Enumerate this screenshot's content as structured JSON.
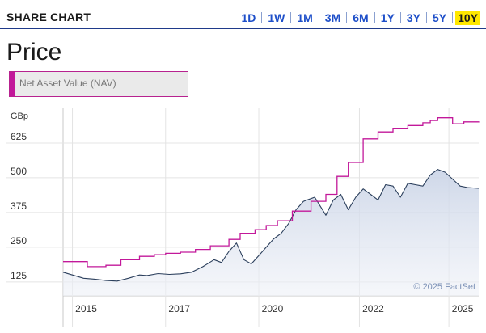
{
  "header": {
    "title": "SHARE CHART",
    "ranges": [
      "1D",
      "1W",
      "1M",
      "3M",
      "6M",
      "1Y",
      "3Y",
      "5Y",
      "10Y"
    ],
    "active_range": "10Y"
  },
  "price_title": "Price",
  "legend": {
    "label": "Net Asset Value (NAV)",
    "color": "#c2189a"
  },
  "colors": {
    "price_line": "#2b3f5c",
    "area_fill": "#dde4ef",
    "nav_line": "#c2189a",
    "accent": "#1e4fc9",
    "active_highlight": "#ffe800"
  },
  "chart_data": {
    "type": "line",
    "title": "",
    "xlabel": "",
    "ylabel": "GBp",
    "xlim": [
      2014.75,
      2025.9
    ],
    "ylim": [
      75,
      750
    ],
    "y_ticks": [
      125,
      250,
      375,
      500,
      625
    ],
    "x_ticks": [
      {
        "value": 2015,
        "label": "2015"
      },
      {
        "value": 2017.5,
        "label": "2017"
      },
      {
        "value": 2020,
        "label": "2020"
      },
      {
        "value": 2022.7,
        "label": "2022"
      },
      {
        "value": 2025.1,
        "label": "2025"
      }
    ],
    "grid": true,
    "credit": "© 2025 FactSet",
    "series": [
      {
        "name": "Net Asset Value (NAV)",
        "style": "step",
        "x": [
          2014.75,
          2015.1,
          2015.4,
          2015.9,
          2016.3,
          2016.8,
          2017.2,
          2017.5,
          2017.9,
          2018.3,
          2018.7,
          2019.2,
          2019.5,
          2019.9,
          2020.2,
          2020.5,
          2020.9,
          2021.4,
          2021.8,
          2022.1,
          2022.4,
          2022.8,
          2023.2,
          2023.6,
          2024.0,
          2024.4,
          2024.6,
          2024.8,
          2025.2,
          2025.5,
          2025.9
        ],
        "values": [
          198,
          198,
          180,
          185,
          205,
          217,
          223,
          228,
          232,
          242,
          255,
          278,
          300,
          313,
          328,
          345,
          380,
          415,
          440,
          505,
          555,
          640,
          665,
          678,
          688,
          698,
          706,
          716,
          694,
          701,
          703
        ]
      },
      {
        "name": "",
        "style": "area",
        "x": [
          2014.75,
          2015.0,
          2015.3,
          2015.6,
          2015.9,
          2016.2,
          2016.5,
          2016.8,
          2017.0,
          2017.3,
          2017.6,
          2017.9,
          2018.2,
          2018.5,
          2018.8,
          2019.0,
          2019.2,
          2019.4,
          2019.6,
          2019.8,
          2020.0,
          2020.2,
          2020.4,
          2020.6,
          2020.8,
          2021.0,
          2021.2,
          2021.5,
          2021.8,
          2022.0,
          2022.2,
          2022.4,
          2022.6,
          2022.8,
          2023.0,
          2023.2,
          2023.4,
          2023.6,
          2023.8,
          2024.0,
          2024.2,
          2024.4,
          2024.6,
          2024.8,
          2025.0,
          2025.2,
          2025.4,
          2025.6,
          2025.9
        ],
        "values": [
          160,
          150,
          138,
          135,
          130,
          128,
          138,
          150,
          148,
          155,
          152,
          154,
          160,
          180,
          205,
          195,
          235,
          265,
          205,
          190,
          220,
          250,
          280,
          300,
          335,
          385,
          415,
          430,
          365,
          420,
          440,
          385,
          430,
          460,
          440,
          420,
          475,
          470,
          430,
          480,
          475,
          470,
          510,
          530,
          520,
          495,
          470,
          465,
          462
        ]
      }
    ]
  }
}
